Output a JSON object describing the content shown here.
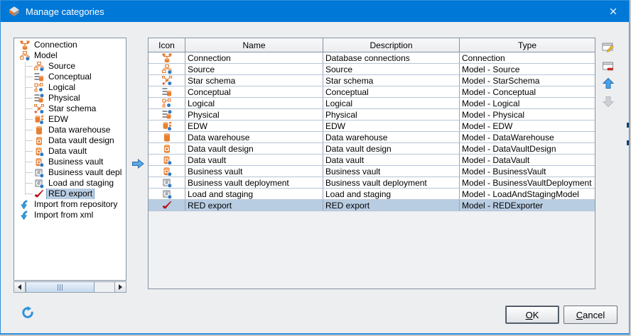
{
  "window": {
    "title": "Manage categories"
  },
  "tree": {
    "items": [
      {
        "label": "Connection",
        "icon": "connection",
        "level": 0,
        "selected": false
      },
      {
        "label": "Model",
        "icon": "model",
        "level": 0,
        "selected": false
      },
      {
        "label": "Source",
        "icon": "source",
        "level": 1,
        "selected": false
      },
      {
        "label": "Conceptual",
        "icon": "conceptual",
        "level": 1,
        "selected": false
      },
      {
        "label": "Logical",
        "icon": "logical",
        "level": 1,
        "selected": false
      },
      {
        "label": "Physical",
        "icon": "physical",
        "level": 1,
        "selected": false
      },
      {
        "label": "Star schema",
        "icon": "star-schema",
        "level": 1,
        "selected": false
      },
      {
        "label": "EDW",
        "icon": "edw",
        "level": 1,
        "selected": false
      },
      {
        "label": "Data warehouse",
        "icon": "data-warehouse",
        "level": 1,
        "selected": false
      },
      {
        "label": "Data vault design",
        "icon": "data-vault-design",
        "level": 1,
        "selected": false
      },
      {
        "label": "Data vault",
        "icon": "data-vault",
        "level": 1,
        "selected": false
      },
      {
        "label": "Business vault",
        "icon": "business-vault",
        "level": 1,
        "selected": false
      },
      {
        "label": "Business vault depl",
        "icon": "business-vault-deployment",
        "level": 1,
        "selected": false
      },
      {
        "label": "Load and staging",
        "icon": "load-and-staging",
        "level": 1,
        "selected": false
      },
      {
        "label": "RED export",
        "icon": "red-export",
        "level": 1,
        "selected": true
      },
      {
        "label": "Import from repository",
        "icon": "import",
        "level": 0,
        "selected": false
      },
      {
        "label": "Import from xml",
        "icon": "import",
        "level": 0,
        "selected": false
      }
    ]
  },
  "table": {
    "columns": [
      "Icon",
      "Name",
      "Description",
      "Type"
    ],
    "rows": [
      {
        "icon": "connection",
        "name": "Connection",
        "description": "Database connections",
        "type": "Connection",
        "selected": false
      },
      {
        "icon": "source",
        "name": "Source",
        "description": "Source",
        "type": "Model - Source",
        "selected": false
      },
      {
        "icon": "star-schema",
        "name": "Star schema",
        "description": "Star schema",
        "type": "Model - StarSchema",
        "selected": false
      },
      {
        "icon": "conceptual",
        "name": "Conceptual",
        "description": "Conceptual",
        "type": "Model - Conceptual",
        "selected": false
      },
      {
        "icon": "logical",
        "name": "Logical",
        "description": "Logical",
        "type": "Model - Logical",
        "selected": false
      },
      {
        "icon": "physical",
        "name": "Physical",
        "description": "Physical",
        "type": "Model - Physical",
        "selected": false
      },
      {
        "icon": "edw",
        "name": "EDW",
        "description": "EDW",
        "type": "Model - EDW",
        "selected": false
      },
      {
        "icon": "data-warehouse",
        "name": "Data warehouse",
        "description": "Data warehouse",
        "type": "Model - DataWarehouse",
        "selected": false
      },
      {
        "icon": "data-vault-design",
        "name": "Data vault design",
        "description": "Data vault design",
        "type": "Model - DataVaultDesign",
        "selected": false
      },
      {
        "icon": "data-vault",
        "name": "Data vault",
        "description": "Data vault",
        "type": "Model - DataVault",
        "selected": false
      },
      {
        "icon": "business-vault",
        "name": "Business vault",
        "description": "Business vault",
        "type": "Model - BusinessVault",
        "selected": false
      },
      {
        "icon": "business-vault-deployment",
        "name": "Business vault deployment",
        "description": "Business vault deployment",
        "type": "Model - BusinessVaultDeployment",
        "selected": false
      },
      {
        "icon": "load-and-staging",
        "name": "Load and staging",
        "description": "Load and staging",
        "type": "Model - LoadAndStagingModel",
        "selected": false
      },
      {
        "icon": "red-export",
        "name": "RED export",
        "description": "RED export",
        "type": "Model - REDExporter",
        "selected": true
      }
    ]
  },
  "side_buttons": [
    {
      "name": "edit-category",
      "icon": "edit-row",
      "enabled": true
    },
    {
      "name": "remove-category",
      "icon": "delete-row",
      "enabled": true
    },
    {
      "name": "move-up",
      "icon": "up-arrow",
      "enabled": true
    },
    {
      "name": "move-down",
      "icon": "down-arrow",
      "enabled": false
    }
  ],
  "footer": {
    "ok": "OK",
    "cancel": "Cancel"
  },
  "colors": {
    "titlebar": "#0078d7",
    "accent_orange": "#e2762a",
    "accent_blue": "#2e78c2",
    "selection": "#b9cde2",
    "window_border": "#2f8fdb"
  }
}
